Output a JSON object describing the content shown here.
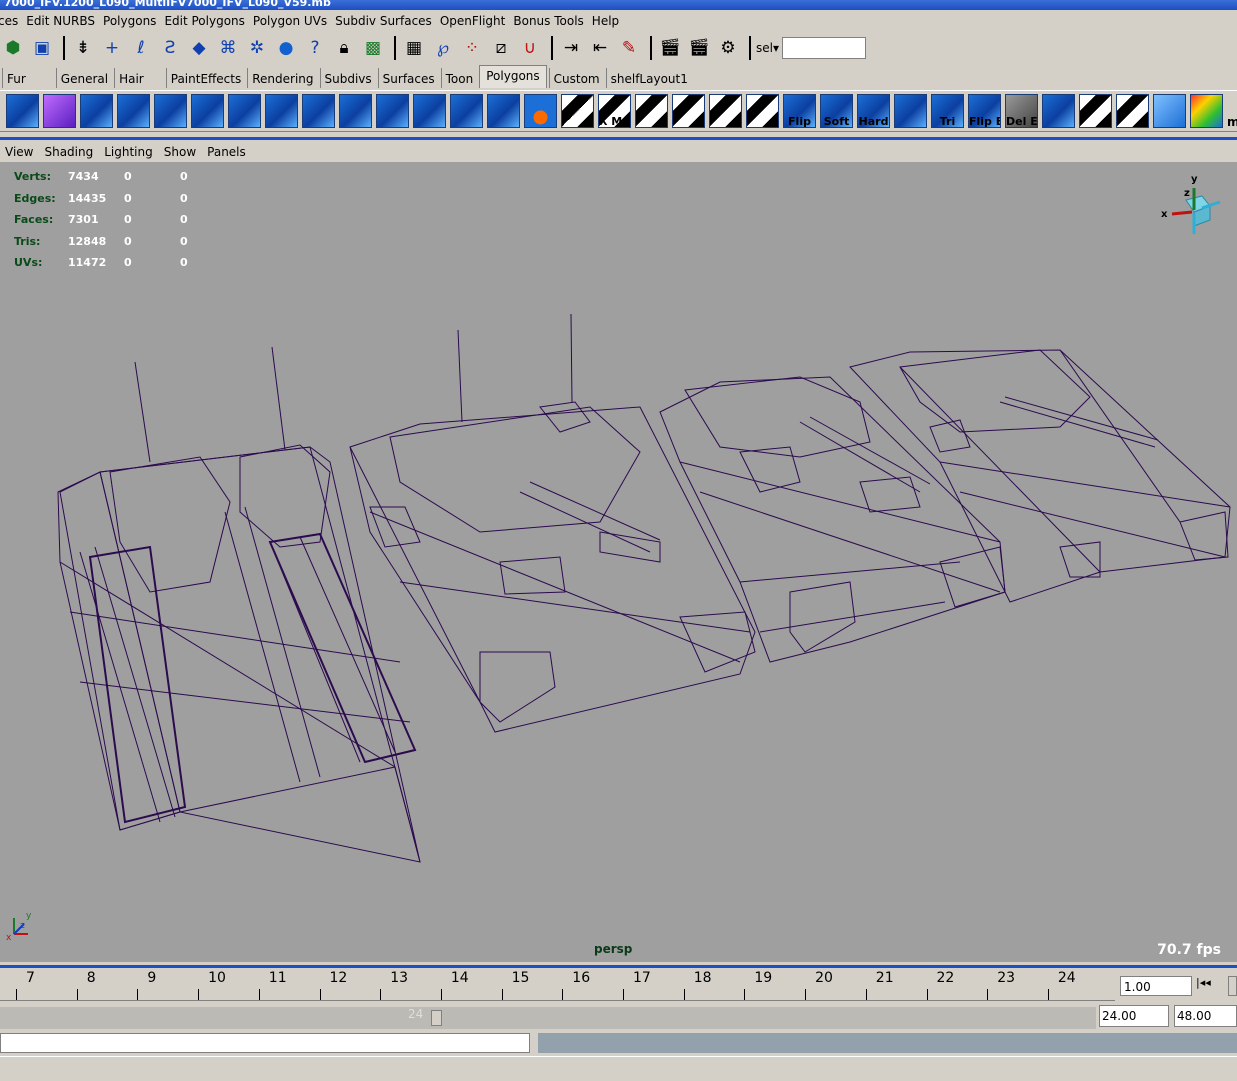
{
  "window": {
    "title": "7000_IFV.1200_L090_MultiIFV7000_IFV_L090_V59.mb"
  },
  "menubar": [
    "ces",
    "Edit NURBS",
    "Polygons",
    "Edit Polygons",
    "Polygon UVs",
    "Subdiv Surfaces",
    "OpenFlight",
    "Bonus Tools",
    "Help"
  ],
  "status_line": {
    "sel_label": "sel▾",
    "sel_value": ""
  },
  "shelf_tabs": [
    "Fur",
    "General",
    "Hair",
    "PaintEffects",
    "Rendering",
    "Subdivs",
    "Surfaces",
    "Toon",
    "Polygons",
    "Custom",
    "shelfLayout1"
  ],
  "shelf_tabs_active": "Polygons",
  "shelf_labels": {
    "xmap": "X Map",
    "flip": "Flip",
    "soft": "Soft",
    "hard": "Hard",
    "tri": "Tri",
    "flipe": "Flip E",
    "dele": "Del E",
    "me": "me Pip"
  },
  "panel_menu": [
    "View",
    "Shading",
    "Lighting",
    "Show",
    "Panels"
  ],
  "hud": {
    "rows": [
      {
        "label": "Verts:",
        "v1": "7434",
        "v2": "0",
        "v3": "0"
      },
      {
        "label": "Edges:",
        "v1": "14435",
        "v2": "0",
        "v3": "0"
      },
      {
        "label": "Faces:",
        "v1": "7301",
        "v2": "0",
        "v3": "0"
      },
      {
        "label": "Tris:",
        "v1": "12848",
        "v2": "0",
        "v3": "0"
      },
      {
        "label": "UVs:",
        "v1": "11472",
        "v2": "0",
        "v3": "0"
      }
    ]
  },
  "viewport": {
    "camera": "persp",
    "fps": "70.7 fps",
    "axis_x": "x",
    "axis_y": "y",
    "axis_z": "z"
  },
  "timeline": {
    "ticks": [
      "7",
      "8",
      "9",
      "10",
      "11",
      "12",
      "13",
      "14",
      "15",
      "16",
      "17",
      "18",
      "19",
      "20",
      "21",
      "22",
      "23",
      "24"
    ],
    "current_time": "1.00"
  },
  "range": {
    "slider_end": "24",
    "start": "24.00",
    "end": "48.00"
  },
  "colors": {
    "viewport_bg": "#9f9f9f",
    "wireframe": "#2c0a4e",
    "accent": "#1c4fc0"
  }
}
